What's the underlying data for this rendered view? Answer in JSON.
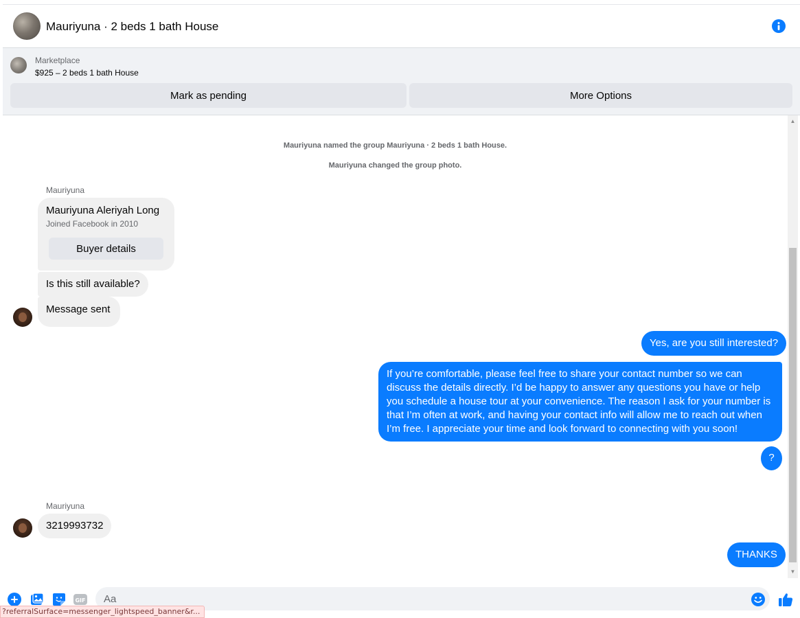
{
  "header": {
    "title": "Mauriyuna · 2 beds 1 bath House",
    "info_icon": "info-icon",
    "accent": "#0a7cff"
  },
  "listing": {
    "source": "Marketplace",
    "title": "$925 – 2 beds 1 bath House",
    "mark_pending_label": "Mark as pending",
    "more_options_label": "More Options"
  },
  "thread": {
    "system_messages": [
      "Mauriyuna named the group Mauriyuna · 2 beds 1 bath House.",
      "Mauriyuna changed the group photo."
    ],
    "sender_name": "Mauriyuna",
    "buyer_card": {
      "name": "Mauriyuna Aleriyah Long",
      "joined": "Joined Facebook in 2010",
      "button_label": "Buyer details"
    },
    "incoming_1": "Is this still available?",
    "incoming_2": "Message sent",
    "outgoing_1": "Yes, are you still interested?",
    "outgoing_2": "If you’re comfortable, please feel free to share your contact number so we can discuss the details directly. I’d be happy to answer any questions you have or help you schedule a house tour at your convenience. The reason I ask for your number is that I’m often at work, and having your contact info will allow me to reach out when I’m free. I appreciate your time and look forward to connecting with you soon!",
    "outgoing_3": "?",
    "incoming_3": "3219993732",
    "outgoing_4": "THANKS"
  },
  "composer": {
    "placeholder": "Aa",
    "icons": [
      "plus-icon",
      "photo-icon",
      "sticker-icon",
      "gif-icon",
      "emoji-icon",
      "thumbs-up-icon"
    ],
    "gif_label": "GIF"
  },
  "status_bar": {
    "url": "?referralSurface=messenger_lightspeed_banner&r..."
  }
}
